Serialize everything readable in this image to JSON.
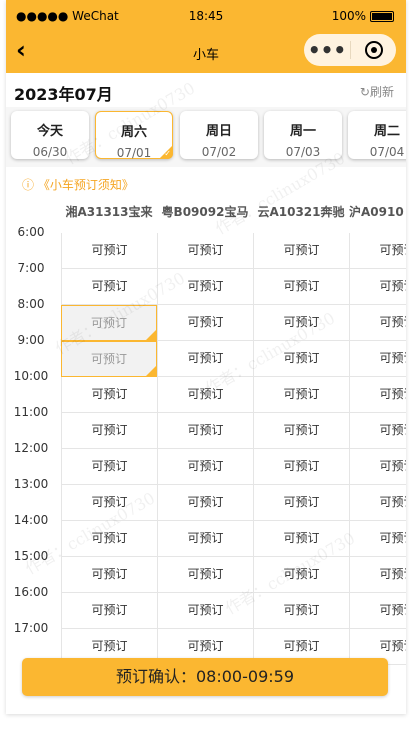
{
  "status_bar": {
    "carrier": "●●●●● WeChat",
    "time": "18:45",
    "battery": "100%"
  },
  "nav": {
    "title": "小车"
  },
  "month": {
    "label": "2023年07月",
    "refresh": "刷新"
  },
  "dates": [
    {
      "weekday": "今天",
      "date": "06/30"
    },
    {
      "weekday": "周六",
      "date": "07/01"
    },
    {
      "weekday": "周日",
      "date": "07/02"
    },
    {
      "weekday": "周一",
      "date": "07/03"
    },
    {
      "weekday": "周二",
      "date": "07/04"
    }
  ],
  "notice": "ⓘ 《小车预订须知》",
  "cars": [
    "湘A31313宝来",
    "粤B09092宝马",
    "云A10321奔驰",
    "沪A0910"
  ],
  "hours": [
    "6:00",
    "7:00",
    "8:00",
    "9:00",
    "10:00",
    "11:00",
    "12:00",
    "13:00",
    "14:00",
    "15:00",
    "16:00",
    "17:00"
  ],
  "cell_label": "可预订",
  "confirm": "预订确认：08:00-09:59",
  "watermark": "作者：cclinux0730",
  "colors": {
    "accent": "#fbb731",
    "notice": "#f5a623"
  }
}
